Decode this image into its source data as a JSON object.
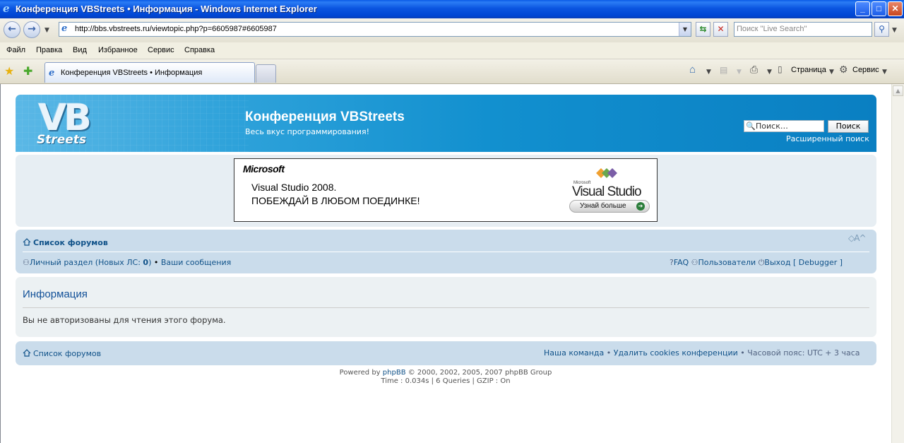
{
  "window": {
    "title": "Конференция VBStreets • Информация - Windows Internet Explorer",
    "buttons": {
      "minimize": "_",
      "maximize": "□",
      "close": "✕"
    }
  },
  "browser": {
    "url": "http://bbs.vbstreets.ru/viewtopic.php?p=6605987#6605987",
    "search_placeholder": "Поиск \"Live Search\"",
    "menu": [
      "Файл",
      "Правка",
      "Вид",
      "Избранное",
      "Сервис",
      "Справка"
    ],
    "tab_label": "Конференция VBStreets • Информация",
    "commands": {
      "page": "Страница",
      "tools": "Сервис"
    }
  },
  "header": {
    "logo": {
      "vb": "VB",
      "streets": "Streets"
    },
    "title": "Конференция VBStreets",
    "description": "Весь вкус программирования!",
    "search_placeholder": "Поиск…",
    "search_button": "Поиск",
    "advanced_search": "Расширенный поиск"
  },
  "ad": {
    "brand": "Microsoft",
    "line1": "Visual Studio 2008.",
    "line2": "ПОБЕЖДАЙ В ЛЮБОМ ПОЕДИНКЕ!",
    "product_small": "Microsoft",
    "product": "Visual Studio",
    "cta": "Узнай больше"
  },
  "nav": {
    "forum_index": "Список форумов",
    "font_size": "◇A^",
    "ucp": {
      "label": "Личный раздел",
      "new_pm_prefix": "(Новых ЛС: ",
      "new_pm_count": "0",
      "new_pm_suffix": ")",
      "bullet": "•",
      "my_posts": "Ваши сообщения"
    },
    "faq": "FAQ",
    "members": "Пользователи",
    "logout": "Выход [ Debugger ]"
  },
  "info": {
    "title": "Информация",
    "message": "Вы не авторизованы для чтения этого форума."
  },
  "footer": {
    "forum_index": "Список форумов",
    "team": "Наша команда",
    "delete_cookies": "Удалить cookies конференции",
    "timezone": "Часовой пояс: UTC + 3 часа",
    "bullet": "•",
    "powered_prefix": "Powered by",
    "powered_link": "phpBB",
    "powered_suffix": "© 2000, 2002, 2005, 2007 phpBB Group",
    "stats": "Time : 0.034s | 6 Queries | GZIP : On"
  }
}
